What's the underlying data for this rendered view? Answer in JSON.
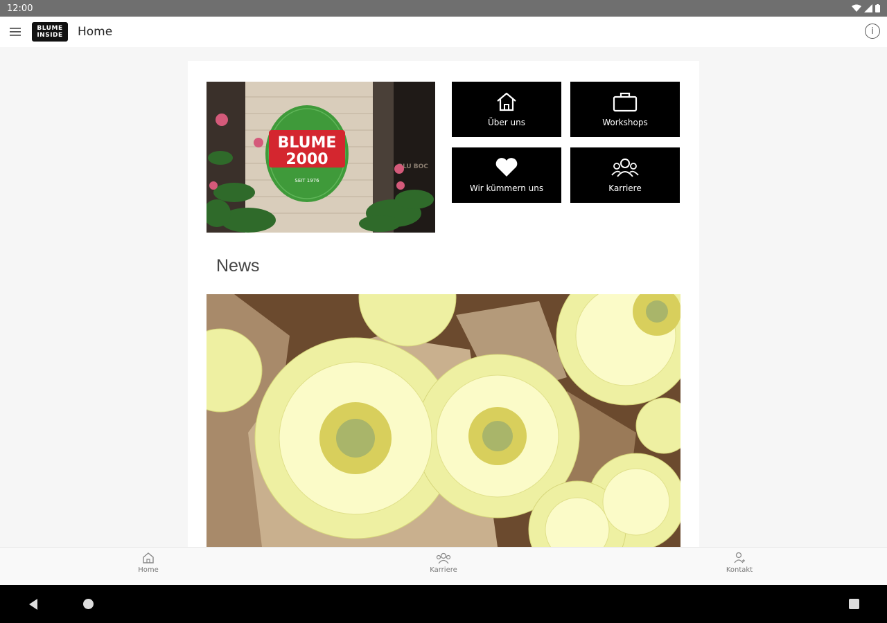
{
  "status_bar": {
    "time": "12:00"
  },
  "app_bar": {
    "logo_top": "BLUME",
    "logo_bottom": "INSIDE",
    "title": "Home"
  },
  "store_photo": {
    "sign_line1": "BLUME",
    "sign_line2": "2000",
    "sign_small": "SEIT 1976",
    "wall_text": "BLU BOC"
  },
  "tiles": [
    {
      "label": "Über uns",
      "icon": "house-icon"
    },
    {
      "label": "Workshops",
      "icon": "briefcase-icon"
    },
    {
      "label": "Wir kümmern uns",
      "icon": "heart-icon"
    },
    {
      "label": "Karriere",
      "icon": "people-icon"
    }
  ],
  "news": {
    "heading": "News"
  },
  "bottom_nav": [
    {
      "label": "Home",
      "icon": "home-icon"
    },
    {
      "label": "Karriere",
      "icon": "people-icon"
    },
    {
      "label": "Kontakt",
      "icon": "contact-icon"
    }
  ],
  "colors": {
    "status_bar": "#6f6f6f",
    "tile_bg": "#000000",
    "sign_green": "#3f9a3a",
    "sign_red": "#d4262f",
    "flower_yellow": "#f2f0a0"
  }
}
